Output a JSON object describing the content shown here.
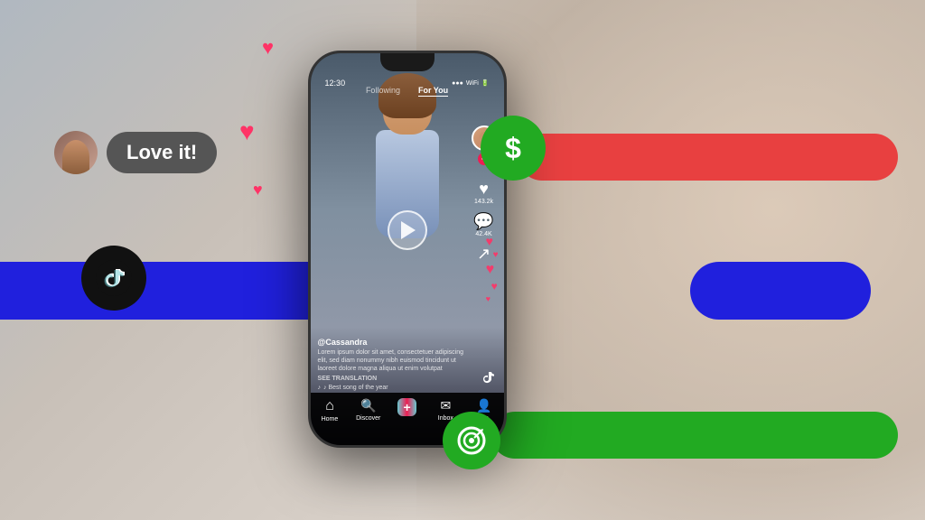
{
  "background": {
    "description": "Blurred woman smiling background"
  },
  "bars": {
    "red_label": "",
    "blue_label": "",
    "green_label": ""
  },
  "icons": {
    "dollar": "$",
    "tiktok": "TikTok",
    "target": "◎"
  },
  "love_bubble": {
    "text": "Love it!"
  },
  "hearts": {
    "decorations": [
      "♥",
      "♥",
      "♥",
      "♥",
      "♥"
    ]
  },
  "phone": {
    "status": {
      "time": "12:30",
      "battery": "🔋",
      "signal": "●●●"
    },
    "tabs": {
      "following": "Following",
      "for_you": "For You"
    },
    "user": "@Cassandra",
    "description": "Lorem ipsum dolor sit amet, consectetuer adipiscing elit, sed diam nonummy nibh euismod tincidunt ut laoreet dolore magna aliqua ut enim volutpat",
    "see_translation": "SEE TRANSLATION",
    "music": "♪ Best song of the year",
    "likes": "143.2k",
    "comments": "42.4K",
    "nav": {
      "home": "Home",
      "discover": "Discover",
      "add": "+",
      "inbox": "Inbox",
      "me": "Me"
    }
  }
}
